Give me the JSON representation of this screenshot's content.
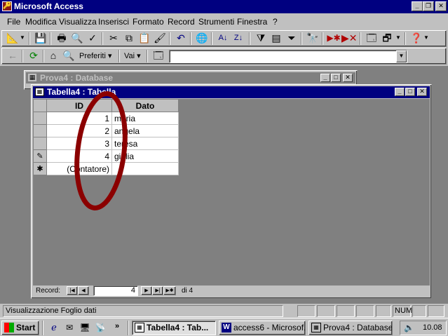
{
  "app": {
    "title": "Microsoft Access"
  },
  "menu": [
    "File",
    "Modifica",
    "Visualizza",
    "Inserisci",
    "Formato",
    "Record",
    "Strumenti",
    "Finestra",
    "?"
  ],
  "web_toolbar": {
    "favorites": "Preferiti",
    "go": "Vai",
    "address": ""
  },
  "db_window": {
    "title": "Prova4 : Database"
  },
  "table_window": {
    "title": "Tabella4 : Tabella",
    "columns": [
      "ID",
      "Dato"
    ],
    "rows": [
      {
        "selector": "",
        "id": "1",
        "dato": "maria"
      },
      {
        "selector": "",
        "id": "2",
        "dato": "angela"
      },
      {
        "selector": "",
        "id": "3",
        "dato": "teresa"
      },
      {
        "selector": "✎",
        "id": "4",
        "dato": "giulia"
      },
      {
        "selector": "✱",
        "id": "(Contatore)",
        "dato": ""
      }
    ],
    "nav": {
      "label": "Record:",
      "current": "4",
      "total": "di 4"
    }
  },
  "status": {
    "text": "Visualizzazione Foglio dati",
    "num": "NUM"
  },
  "taskbar": {
    "start": "Start",
    "tasks": [
      "Tabella4 : Tab...",
      "access6 - Microsof...",
      "Prova4 : Database"
    ],
    "clock": "10.08"
  },
  "colors": {
    "titlebar": "#000080",
    "annotation": "#8b0000"
  }
}
